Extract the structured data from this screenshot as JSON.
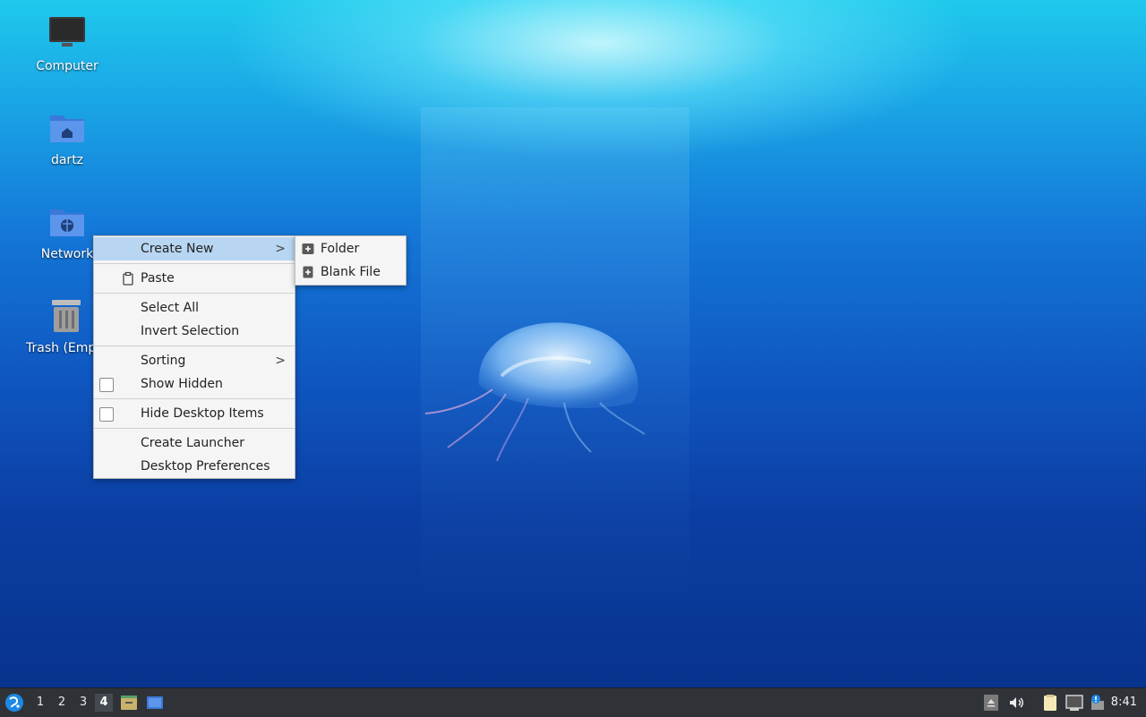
{
  "desktop": {
    "icons": [
      {
        "label": "Computer"
      },
      {
        "label": "dartz"
      },
      {
        "label": "Network"
      },
      {
        "label": "Trash (Empty)"
      }
    ]
  },
  "context_menu": {
    "create_new": "Create New",
    "paste": "Paste",
    "select_all": "Select All",
    "invert_selection": "Invert Selection",
    "sorting": "Sorting",
    "show_hidden": "Show Hidden",
    "hide_desktop_items": "Hide Desktop Items",
    "create_launcher": "Create Launcher",
    "desktop_preferences": "Desktop Preferences",
    "show_hidden_checked": false,
    "hide_desktop_items_checked": false
  },
  "submenu": {
    "folder": "Folder",
    "blank_file": "Blank File"
  },
  "taskbar": {
    "workspaces": [
      "1",
      "2",
      "3",
      "4"
    ],
    "active_workspace": "4",
    "clock": "8:41",
    "icons": [
      "start-menu-icon",
      "file-manager-icon",
      "desktop-icon",
      "eject-icon",
      "volume-icon",
      "clipboard-icon",
      "network-icon",
      "updates-icon"
    ]
  },
  "colors": {
    "menu_highlight": "#b8d6f2",
    "taskbar_bg": "#2f3338"
  }
}
